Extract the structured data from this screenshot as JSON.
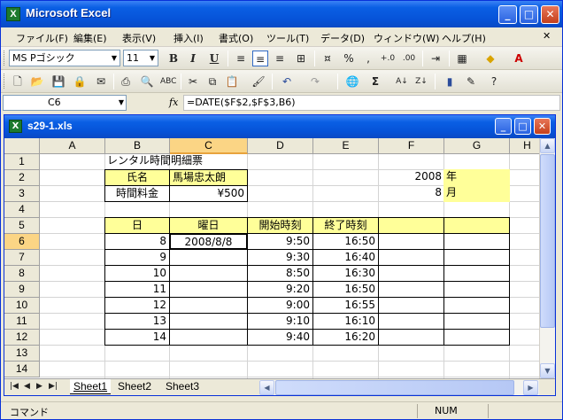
{
  "app": {
    "title": "Microsoft Excel",
    "minimize": "_",
    "maximize": "□",
    "close": "✕"
  },
  "menu": {
    "items": [
      "ファイル(F)",
      "編集(E)",
      "表示(V)",
      "挿入(I)",
      "書式(O)",
      "ツール(T)",
      "データ(D)",
      "ウィンドウ(W)",
      "ヘルプ(H)"
    ]
  },
  "format_toolbar": {
    "font": "MS Pゴシック",
    "size": "11",
    "bold": "B",
    "italic": "I",
    "underline": "U",
    "percent": "%",
    "comma": ","
  },
  "formula_bar": {
    "name_box": "C6",
    "fx": "fx",
    "formula": "=DATE($F$2,$F$3,B6)"
  },
  "workbook": {
    "name": "s29-1.xls"
  },
  "columns": [
    "A",
    "B",
    "C",
    "D",
    "E",
    "F",
    "G",
    "H"
  ],
  "rows": [
    "1",
    "2",
    "3",
    "4",
    "5",
    "6",
    "7",
    "8",
    "9",
    "10",
    "11",
    "12",
    "13",
    "14"
  ],
  "sheet": {
    "title": "レンタル時間明細票",
    "name_label": "氏名",
    "name_value": "馬場忠太朗",
    "rate_label": "時間料金",
    "rate_value": "¥500",
    "year_value": "2008",
    "year_label": "年",
    "month_value": "8",
    "month_label": "月",
    "headers": {
      "day": "日",
      "weekday": "曜日",
      "start": "開始時刻",
      "end": "終了時刻"
    },
    "data": [
      {
        "day": "8",
        "weekday": "2008/8/8",
        "start": "9:50",
        "end": "16:50"
      },
      {
        "day": "9",
        "weekday": "",
        "start": "9:30",
        "end": "16:40"
      },
      {
        "day": "10",
        "weekday": "",
        "start": "8:50",
        "end": "16:30"
      },
      {
        "day": "11",
        "weekday": "",
        "start": "9:20",
        "end": "16:50"
      },
      {
        "day": "12",
        "weekday": "",
        "start": "9:00",
        "end": "16:55"
      },
      {
        "day": "13",
        "weekday": "",
        "start": "9:10",
        "end": "16:10"
      },
      {
        "day": "14",
        "weekday": "",
        "start": "9:40",
        "end": "16:20"
      }
    ]
  },
  "tabs": [
    "Sheet1",
    "Sheet2",
    "Sheet3"
  ],
  "status": {
    "mode": "コマンド",
    "num": "NUM"
  }
}
